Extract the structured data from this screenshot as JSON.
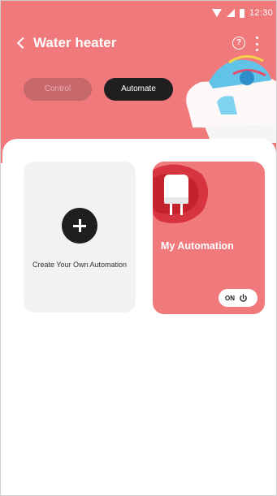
{
  "status_bar": {
    "time": "12:30",
    "icons": [
      "wifi-icon",
      "signal-icon",
      "battery-icon"
    ]
  },
  "header": {
    "title": "Water heater",
    "back_icon": "chevron-left-icon",
    "help_icon": "help-circle-icon",
    "help_symbol": "?",
    "more_icon": "more-vertical-icon",
    "bg_color": "#f07a7b"
  },
  "tabs": [
    {
      "label": "Control",
      "selected": false
    },
    {
      "label": "Automate",
      "selected": true
    }
  ],
  "cards": {
    "create": {
      "label": "Create Your Own Automation",
      "icon": "plus-icon"
    },
    "automation": {
      "label": "My Automation",
      "icon": "water-heater-icon",
      "toggle_label": "ON",
      "toggle_state": true,
      "toggle_icon": "power-icon"
    }
  },
  "colors": {
    "accent": "#f07a7b",
    "dark": "#1f1f1f",
    "card_gray": "#f2f2f2"
  }
}
